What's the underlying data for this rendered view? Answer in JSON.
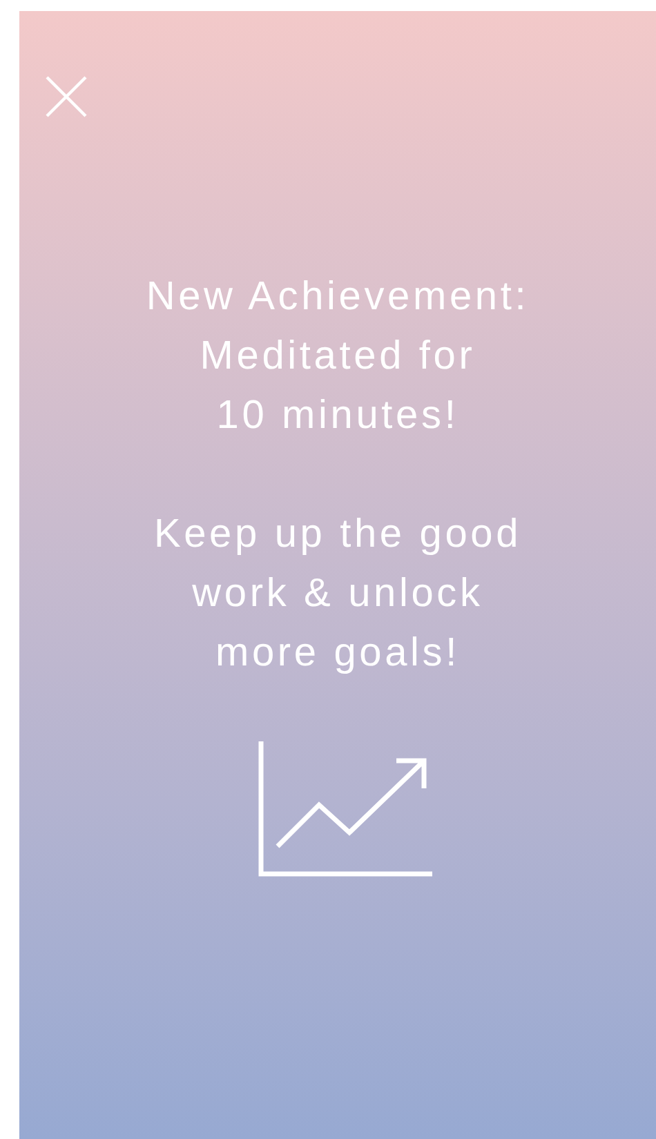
{
  "achievement": {
    "title": "New Achievement:\nMeditated for\n10 minutes!",
    "message": "Keep up the good\nwork & unlock\nmore goals!"
  }
}
